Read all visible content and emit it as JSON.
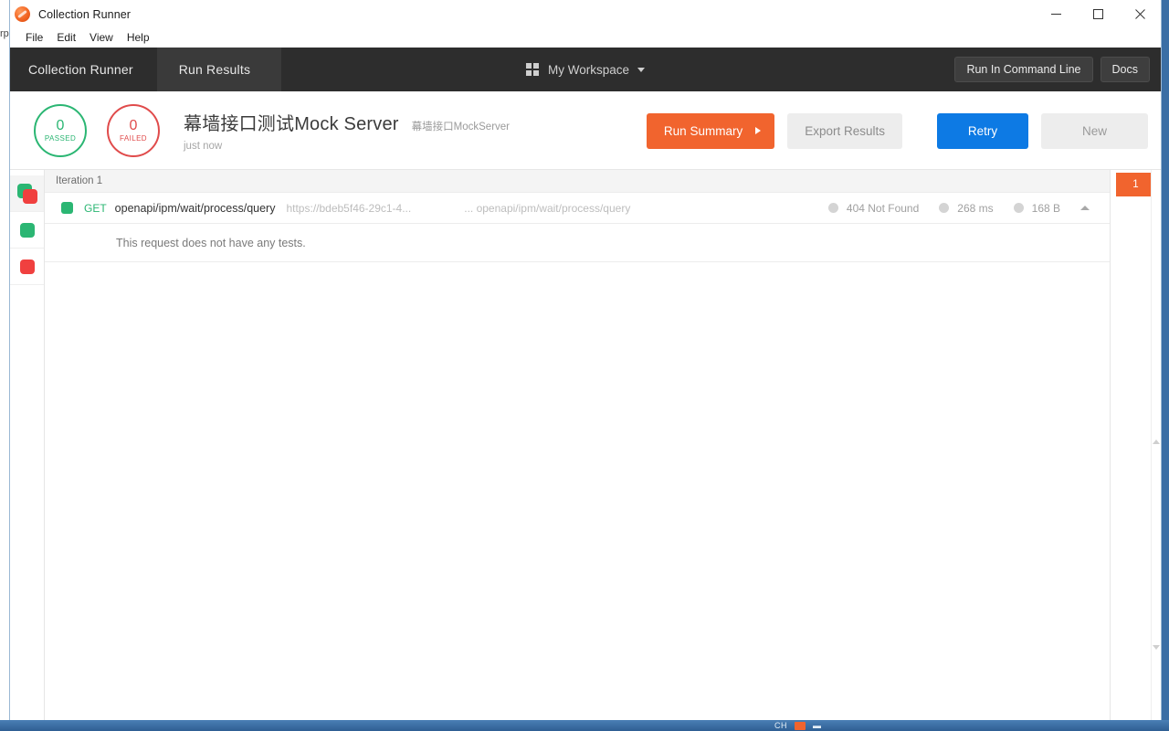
{
  "window": {
    "title": "Collection Runner",
    "app_icon": "postman-runner-icon",
    "controls": {
      "minimize": "minimize-icon",
      "maximize": "maximize-icon",
      "close": "close-icon"
    }
  },
  "menubar": {
    "items": [
      {
        "label": "File"
      },
      {
        "label": "Edit"
      },
      {
        "label": "View"
      },
      {
        "label": "Help"
      }
    ]
  },
  "header": {
    "tabs": [
      {
        "label": "Collection Runner",
        "active": false
      },
      {
        "label": "Run Results",
        "active": true
      }
    ],
    "workspace": {
      "icon": "grid-icon",
      "label": "My Workspace",
      "caret": "chevron-down-icon"
    },
    "actions": [
      {
        "label": "Run In Command Line"
      },
      {
        "label": "Docs"
      }
    ]
  },
  "summary": {
    "passed": {
      "count": "0",
      "label": "PASSED",
      "color": "#2bb673"
    },
    "failed": {
      "count": "0",
      "label": "FAILED",
      "color": "#e04b4b"
    },
    "run_title": "幕墙接口测试Mock Server",
    "collection_name": "幕墙接口MockServer",
    "run_time": "just now",
    "buttons": {
      "run_summary": "Run Summary",
      "export_results": "Export Results",
      "retry": "Retry",
      "new": "New"
    },
    "colors": {
      "run_summary_bg": "#f1642e",
      "retry_bg": "#0d7ae4",
      "muted_bg": "#ededed"
    }
  },
  "rail": {
    "items": [
      {
        "name": "filter-all",
        "chips": [
          "green",
          "red"
        ],
        "selected": true
      },
      {
        "name": "filter-passed",
        "chips": [
          "green"
        ],
        "selected": false
      },
      {
        "name": "filter-failed",
        "chips": [
          "red"
        ],
        "selected": false
      }
    ]
  },
  "results": {
    "iteration_label": "Iteration 1",
    "request": {
      "method": "GET",
      "name": "openapi/ipm/wait/process/query",
      "url_left": "https://bdeb5f46-29c1-4...",
      "url_right": "... openapi/ipm/wait/process/query",
      "status": "404 Not Found",
      "time": "268 ms",
      "size": "168 B",
      "collapse_icon": "chevron-up-icon"
    },
    "test_message": "This request does not have any tests."
  },
  "minimap": {
    "badge": "1",
    "badge_color": "#f1642e"
  },
  "taskbar": {
    "label": "CH"
  },
  "desktop": {
    "ghost_text": "rp"
  }
}
